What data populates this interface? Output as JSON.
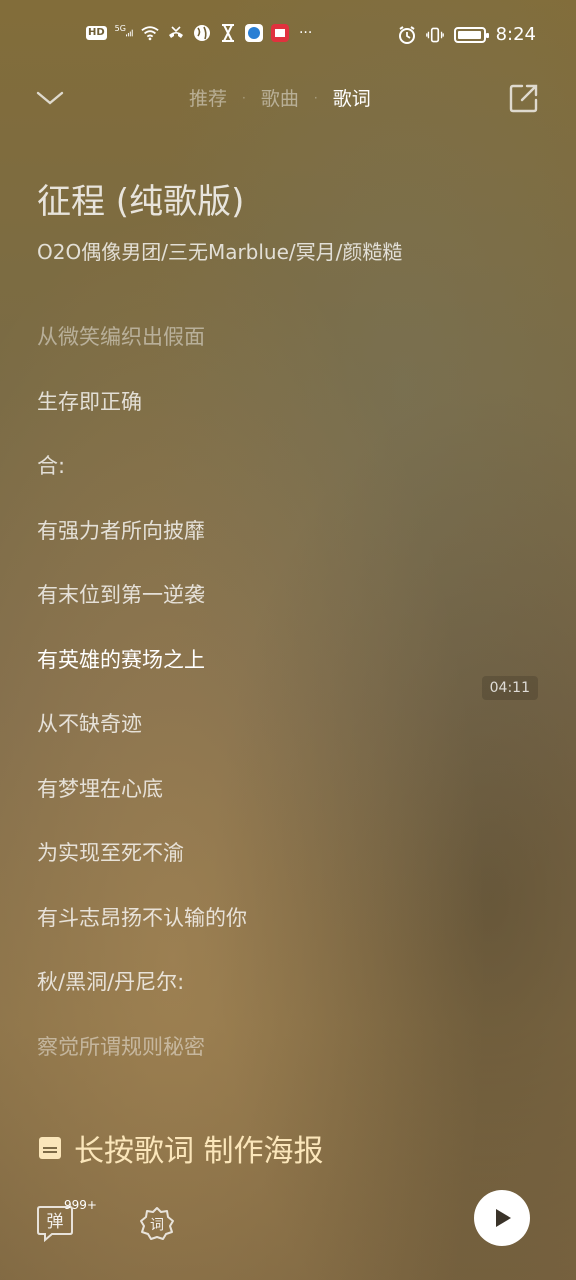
{
  "status_bar": {
    "hd": "HD",
    "network": "5G",
    "more": "···",
    "time": "8:24",
    "battery_level": 0.9
  },
  "nav": {
    "tabs": [
      {
        "label": "推荐",
        "active": false
      },
      {
        "label": "歌曲",
        "active": false
      },
      {
        "label": "歌词",
        "active": true
      }
    ],
    "separator": "·"
  },
  "song": {
    "title": "征程 (纯歌版)",
    "artist": "O2O偶像男团/三无Marblue/冥月/颜糙糙"
  },
  "lyrics": [
    {
      "text": "从微笑编织出假面",
      "state": "dim"
    },
    {
      "text": "生存即正确",
      "state": "normal"
    },
    {
      "text": "合:",
      "state": "normal"
    },
    {
      "text": "有强力者所向披靡",
      "state": "normal"
    },
    {
      "text": "有末位到第一逆袭",
      "state": "normal"
    },
    {
      "text": "有英雄的赛场之上",
      "state": "current"
    },
    {
      "text": "从不缺奇迹",
      "state": "normal"
    },
    {
      "text": "有梦埋在心底",
      "state": "normal"
    },
    {
      "text": "为实现至死不渝",
      "state": "normal"
    },
    {
      "text": "有斗志昂扬不认输的你",
      "state": "normal"
    },
    {
      "text": "秋/黑洞/丹尼尔:",
      "state": "normal"
    },
    {
      "text": "察觉所谓规则秘密",
      "state": "dim"
    }
  ],
  "timestamp": "04:11",
  "poster_tip": {
    "label": "长按歌词 制作海报",
    "icon": "poster-icon"
  },
  "bottom": {
    "danmu_label": "弹",
    "danmu_count": "999+",
    "lyric_label": "词"
  },
  "colors": {
    "accent_text": "#fbe6ba",
    "background": "#7d6a46"
  }
}
